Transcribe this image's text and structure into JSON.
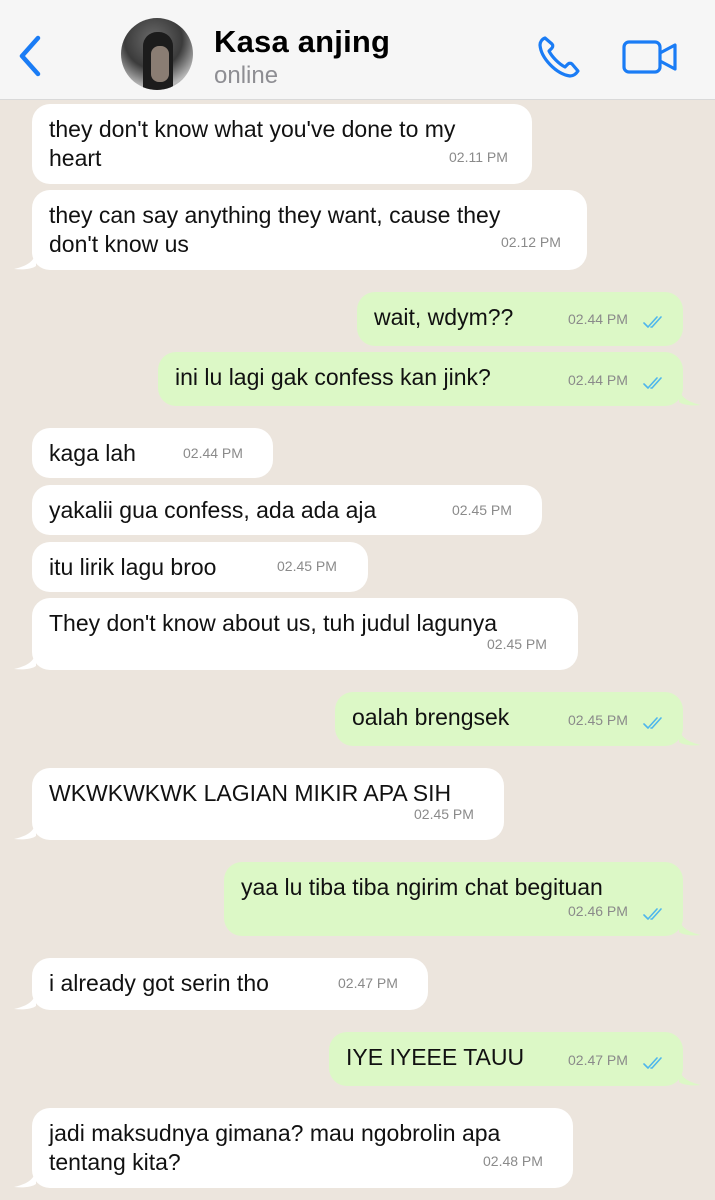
{
  "header": {
    "contact_name": "Kasa anjing",
    "status": "online",
    "accent_color": "#1a7cf5"
  },
  "messages": [
    {
      "direction": "in",
      "text": "they don't know what you've done to my\nheart",
      "time": "02.11 PM"
    },
    {
      "direction": "in",
      "text": "they can say anything they want, cause they\ndon't know us",
      "time": "02.12 PM"
    },
    {
      "direction": "out",
      "text": "wait, wdym??",
      "time": "02.44 PM",
      "read": true
    },
    {
      "direction": "out",
      "text": "ini lu lagi gak confess kan jink?",
      "time": "02.44 PM",
      "read": true
    },
    {
      "direction": "in",
      "text": "kaga lah",
      "time": "02.44 PM"
    },
    {
      "direction": "in",
      "text": "yakalii gua confess, ada ada aja",
      "time": "02.45 PM"
    },
    {
      "direction": "in",
      "text": "itu lirik lagu broo",
      "time": "02.45 PM"
    },
    {
      "direction": "in",
      "text": "They don't know about us, tuh judul lagunya",
      "time": "02.45 PM"
    },
    {
      "direction": "out",
      "text": "oalah brengsek",
      "time": "02.45 PM",
      "read": true
    },
    {
      "direction": "in",
      "text": "WKWKWKWK LAGIAN MIKIR APA SIH",
      "time": "02.45 PM"
    },
    {
      "direction": "out",
      "text": "yaa lu tiba tiba ngirim chat begituan",
      "time": "02.46 PM",
      "read": true
    },
    {
      "direction": "in",
      "text": "i already got serin tho",
      "time": "02.47 PM"
    },
    {
      "direction": "out",
      "text": "IYE IYEEE TAUU",
      "time": "02.47 PM",
      "read": true
    },
    {
      "direction": "in",
      "text": "jadi maksudnya gimana? mau ngobrolin apa\ntentang kita?",
      "time": "02.48 PM"
    }
  ],
  "colors": {
    "incoming_bubble": "#ffffff",
    "outgoing_bubble": "#dcf8c6",
    "chat_background": "#ece5dd",
    "read_tick": "#4fb6ec"
  }
}
